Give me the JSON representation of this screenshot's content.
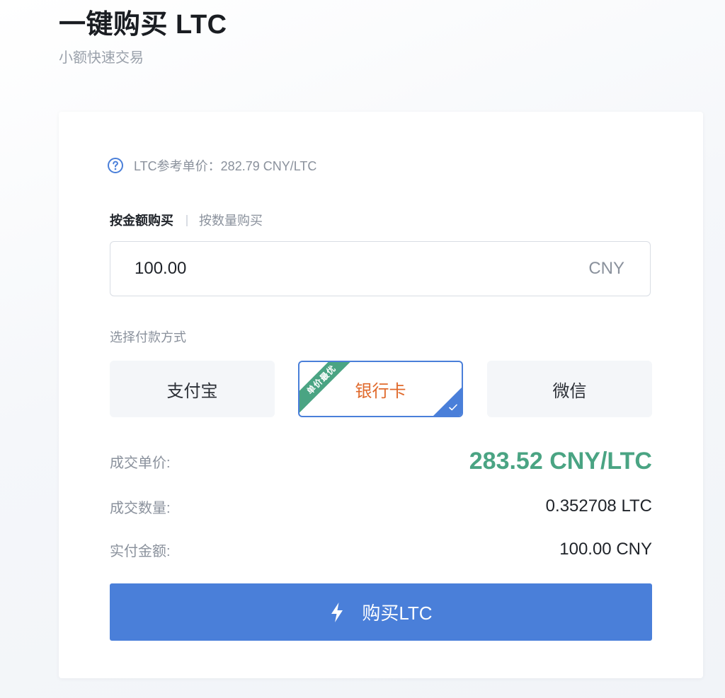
{
  "header": {
    "title": "一键购买 LTC",
    "subtitle": "小额快速交易"
  },
  "reference": {
    "icon": "question-circle-icon",
    "text": "LTC参考单价：282.79 CNY/LTC"
  },
  "mode_tabs": {
    "by_amount": "按金额购买",
    "by_quantity": "按数量购买",
    "active": "by_amount"
  },
  "amount": {
    "value": "100.00",
    "unit": "CNY"
  },
  "payment": {
    "label": "选择付款方式",
    "options": [
      {
        "label": "支付宝",
        "selected": false
      },
      {
        "label": "银行卡",
        "selected": true,
        "badge": "单价最优"
      },
      {
        "label": "微信",
        "selected": false
      }
    ]
  },
  "summary": {
    "price_label": "成交单价:",
    "price_value": "283.52 CNY/LTC",
    "qty_label": "成交数量:",
    "qty_value": "0.352708 LTC",
    "paid_label": "实付金额:",
    "paid_value": "100.00 CNY"
  },
  "buy_button": {
    "label": "购买LTC",
    "icon": "lightning-bolt-icon"
  },
  "colors": {
    "accent_blue": "#4a7fd9",
    "price_green": "#4aa483",
    "selected_text_orange": "#e06a2c",
    "muted_text": "#8a919c"
  }
}
